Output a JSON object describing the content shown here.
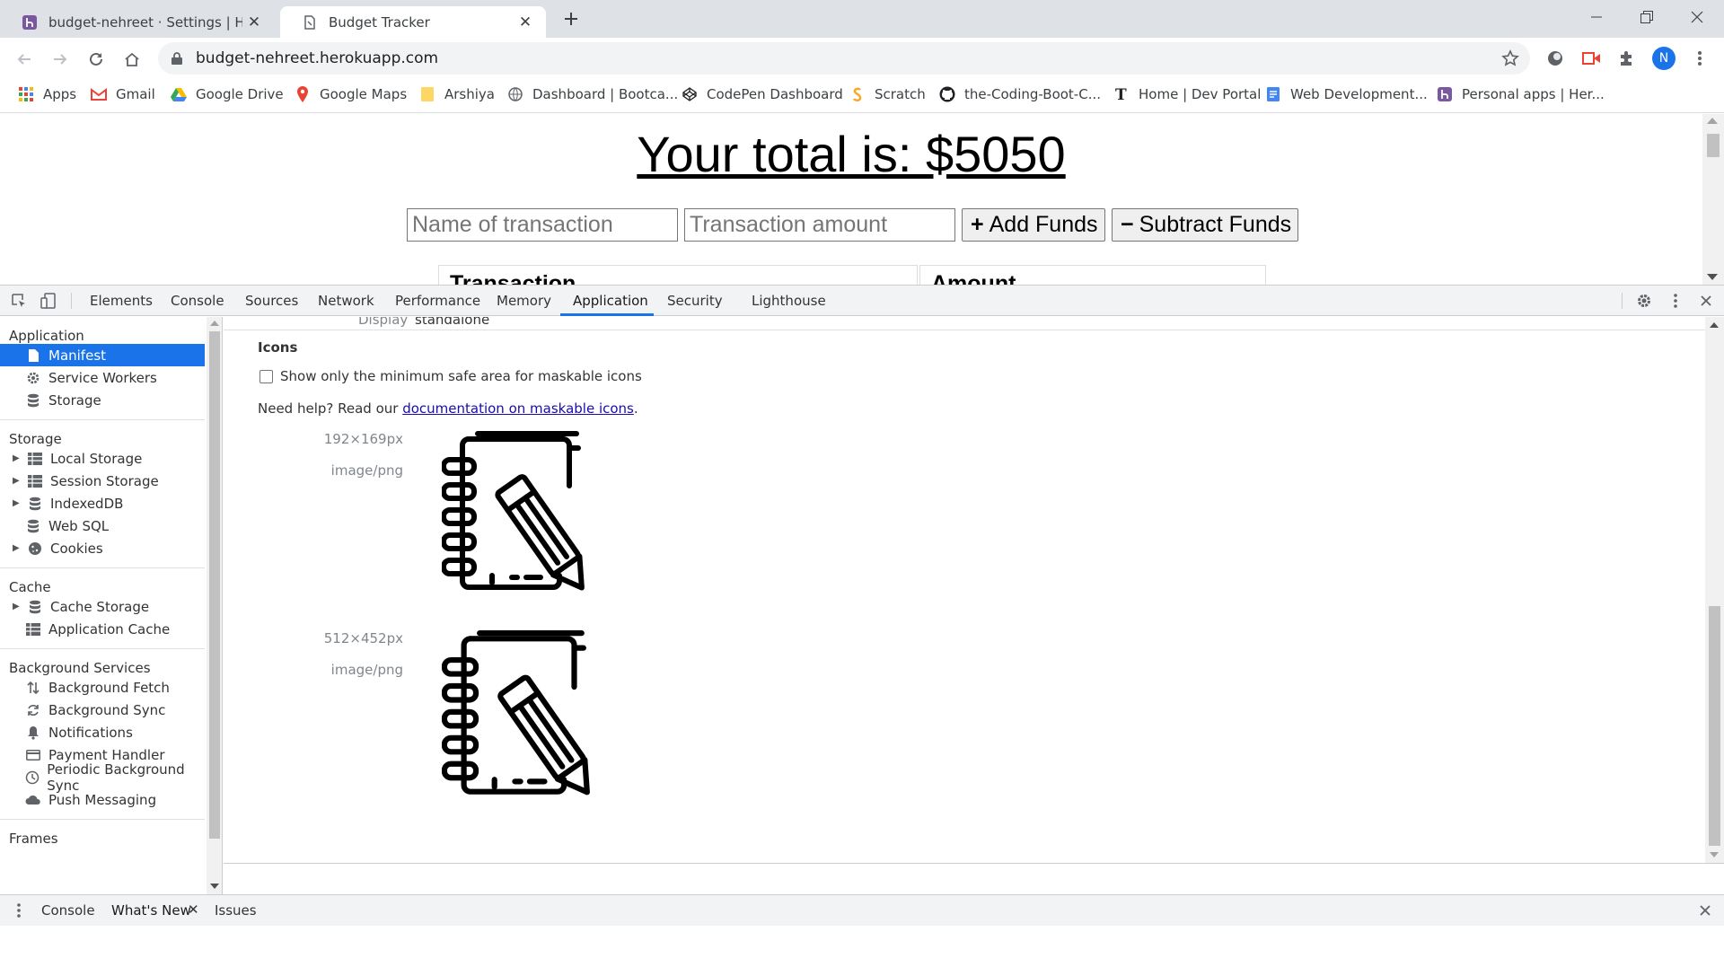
{
  "browser": {
    "tabs": [
      {
        "title": "budget-nehreet · Settings | Herol",
        "active": false
      },
      {
        "title": "Budget Tracker",
        "active": true
      }
    ],
    "url": "budget-nehreet.herokuapp.com",
    "profile_initial": "N",
    "accent_color": "#1a73e8"
  },
  "bookmarks": [
    {
      "label": "Apps",
      "icon": "apps-grid-icon"
    },
    {
      "label": "Gmail",
      "icon": "gmail-icon"
    },
    {
      "label": "Google Drive",
      "icon": "google-drive-icon"
    },
    {
      "label": "Google Maps",
      "icon": "google-maps-icon"
    },
    {
      "label": "Arshiya",
      "icon": "folder-icon"
    },
    {
      "label": "Dashboard | Bootca...",
      "icon": "globe-icon"
    },
    {
      "label": "CodePen Dashboard",
      "icon": "codepen-icon"
    },
    {
      "label": "Scratch",
      "icon": "scratch-icon"
    },
    {
      "label": "the-Coding-Boot-C...",
      "icon": "github-icon"
    },
    {
      "label": "Home | Dev Portal",
      "icon": "nyt-icon"
    },
    {
      "label": "Web Development...",
      "icon": "docs-icon"
    },
    {
      "label": "Personal apps | Her...",
      "icon": "heroku-icon"
    }
  ],
  "page": {
    "total": "Your total is: $5050",
    "name_placeholder": "Name of transaction",
    "amount_placeholder": "Transaction amount",
    "add_symbol": "+",
    "add_label": "Add Funds",
    "subtract_symbol": "−",
    "subtract_label": "Subtract Funds",
    "col_transaction": "Transaction",
    "col_amount": "Amount"
  },
  "devtools": {
    "tabs": [
      "Elements",
      "Console",
      "Sources",
      "Network",
      "Performance",
      "Memory",
      "Application",
      "Security",
      "Lighthouse"
    ],
    "active_tab": "Application",
    "sidebar": {
      "application": {
        "title": "Application",
        "items": [
          "Manifest",
          "Service Workers",
          "Storage"
        ]
      },
      "storage": {
        "title": "Storage",
        "items": [
          "Local Storage",
          "Session Storage",
          "IndexedDB",
          "Web SQL",
          "Cookies"
        ]
      },
      "cache": {
        "title": "Cache",
        "items": [
          "Cache Storage",
          "Application Cache"
        ]
      },
      "background": {
        "title": "Background Services",
        "items": [
          "Background Fetch",
          "Background Sync",
          "Notifications",
          "Payment Handler",
          "Periodic Background Sync",
          "Push Messaging"
        ]
      },
      "frames": {
        "title": "Frames"
      }
    },
    "manifest": {
      "display_label": "Display",
      "display_value": "standalone",
      "icons_heading": "Icons",
      "maskable_checkbox_label": "Show only the minimum safe area for maskable icons",
      "maskable_checked": false,
      "help_prefix": "Need help? Read our ",
      "help_link": "documentation on maskable icons",
      "help_suffix": ".",
      "icons": [
        {
          "size": "192×169px",
          "type": "image/png"
        },
        {
          "size": "512×452px",
          "type": "image/png"
        }
      ]
    },
    "drawer_tabs": [
      "Console",
      "What's New",
      "Issues"
    ]
  }
}
